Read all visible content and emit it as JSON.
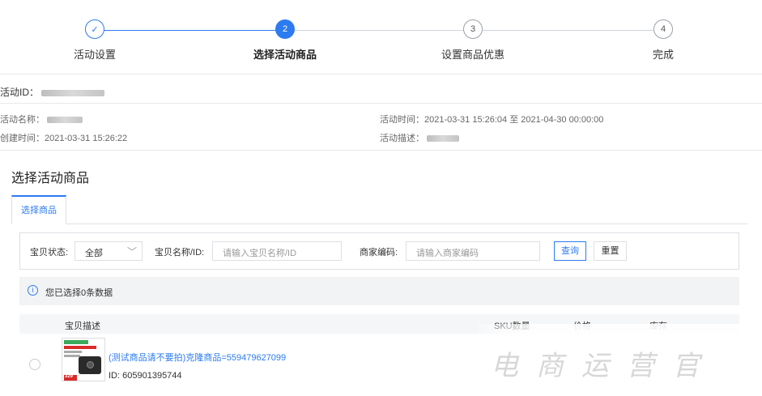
{
  "steps": [
    {
      "num": "✓",
      "label": "活动设置",
      "state": "done"
    },
    {
      "num": "2",
      "label": "选择活动商品",
      "state": "active"
    },
    {
      "num": "3",
      "label": "设置商品优惠",
      "state": "todo"
    },
    {
      "num": "4",
      "label": "完成",
      "state": "todo"
    }
  ],
  "activity": {
    "id_label": "活动ID：",
    "name_label": "活动名称：",
    "created_label": "创建时间：",
    "created_value": "2021-03-31 15:26:22",
    "time_label": "活动时间：",
    "time_value": "2021-03-31 15:26:04 至 2021-04-30 00:00:00",
    "desc_label": "活动描述："
  },
  "section_title": "选择活动商品",
  "tab_label": "选择商品",
  "filter": {
    "status_label": "宝贝状态:",
    "status_value": "全部",
    "name_label": "宝贝名称/ID:",
    "name_placeholder": "请输入宝贝名称/ID",
    "code_label": "商家编码:",
    "code_placeholder": "请输入商家编码",
    "query_button": "查询",
    "reset_button": "重置"
  },
  "notice": "您已选择0条数据",
  "table": {
    "headers": [
      "宝贝描述",
      "SKU数量",
      "价格",
      "库存"
    ],
    "rows": [
      {
        "name": "(测试商品请不要拍)克隆商品=559479627099",
        "id_label": "ID:",
        "id": "605901395744"
      }
    ]
  },
  "thumbnail_price": "329",
  "watermark": "电商运营官"
}
